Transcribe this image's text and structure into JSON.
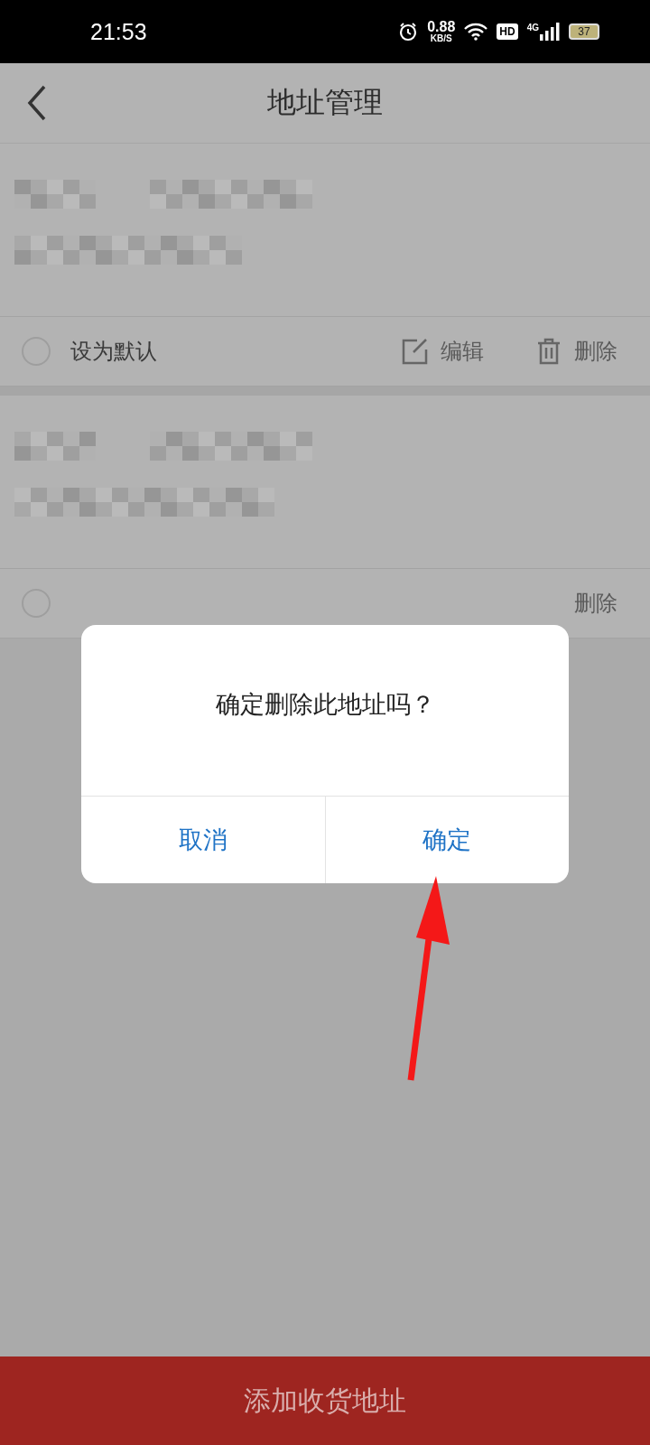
{
  "status_bar": {
    "time": "21:53",
    "net_speed": "0.88",
    "net_speed_unit": "KB/S",
    "hd": "HD",
    "network": "4G",
    "battery": "37"
  },
  "header": {
    "title": "地址管理"
  },
  "addresses": [
    {
      "default_label": "设为默认",
      "selected": false,
      "edit_label": "编辑",
      "delete_label": "删除"
    },
    {
      "selected": false,
      "delete_label": "删除"
    }
  ],
  "dialog": {
    "message": "确定删除此地址吗？",
    "buttons": [
      {
        "label": "取消"
      },
      {
        "label": "确定"
      }
    ]
  },
  "footer": {
    "button": "添加收货地址"
  },
  "annotation": {
    "kind": "arrow"
  }
}
